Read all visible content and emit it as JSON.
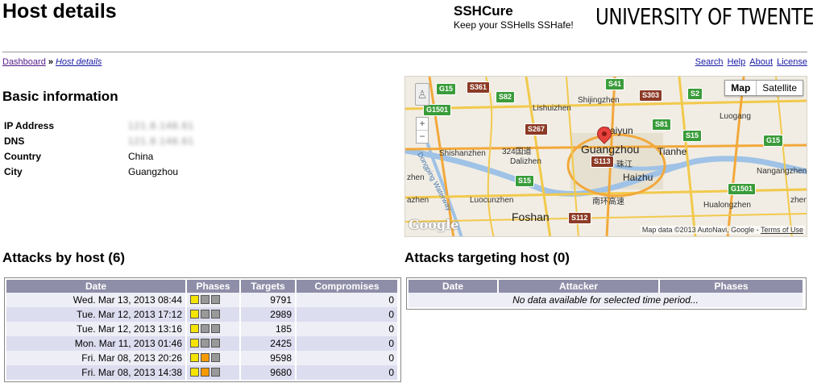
{
  "header": {
    "title": "Host details",
    "brand_name": "SSHCure",
    "brand_tagline": "Keep your SSHells SSHafe!",
    "university": "UNIVERSITY OF TWENTE."
  },
  "breadcrumb": {
    "home": "Dashboard",
    "separator": "»",
    "current": "Host details"
  },
  "toplinks": [
    "Search",
    "Help",
    "About",
    "License"
  ],
  "basic_info": {
    "heading": "Basic information",
    "rows": [
      {
        "label": "IP Address",
        "value": "121.8.148.61",
        "obscured": true
      },
      {
        "label": "DNS",
        "value": "121.8.148.61",
        "obscured": true
      },
      {
        "label": "Country",
        "value": "China",
        "obscured": false
      },
      {
        "label": "City",
        "value": "Guangzhou",
        "obscured": false
      }
    ]
  },
  "map": {
    "type_active": "Map",
    "type_other": "Satellite",
    "zoom_in": "+",
    "zoom_out": "−",
    "logo": "Google",
    "attribution": "Map data ©2013 AutoNavi, Google - ",
    "terms": "Terms of Use",
    "labels": {
      "shijingzhen": "Shijingzhen",
      "lishuizhen": "Lishuizhen",
      "baiyun": "Baiyun",
      "luogang": "Luogang",
      "shishanzhen": "Shishanzhen",
      "road324": "324国道",
      "guangzhou": "Guangzhou",
      "tianhe": "Tianhe",
      "dalizhen": "Dalizhen",
      "haizhu": "Haizhu",
      "zhujiang": "珠江",
      "nangangzhen": "Nangangzhen",
      "luocunzhen": "Luocunzhen",
      "ring": "南环高速",
      "foshan": "Foshan",
      "hualongzhen": "Hualongzhen",
      "waterway": "Dongping Waterway",
      "left_zhen": "zhen",
      "left_azhen": "azhen",
      "right_zhen": "zhen"
    },
    "shields": [
      "G15",
      "S361",
      "S82",
      "S41",
      "S303",
      "S2",
      "G1501",
      "S81",
      "S15",
      "G15",
      "S267",
      "S113",
      "S15",
      "S112",
      "G1501"
    ]
  },
  "attacks_by_host": {
    "heading": "Attacks by host (6)",
    "columns": [
      "Date",
      "Phases",
      "Targets",
      "Compromises"
    ],
    "rows": [
      {
        "date": "Wed. Mar 13, 2013 08:44",
        "phases": [
          "#f5e400",
          "#999999",
          "#999999"
        ],
        "targets": "9791",
        "compromises": "0"
      },
      {
        "date": "Tue. Mar 12, 2013 17:12",
        "phases": [
          "#f5e400",
          "#999999",
          "#999999"
        ],
        "targets": "2989",
        "compromises": "0"
      },
      {
        "date": "Tue. Mar 12, 2013 13:16",
        "phases": [
          "#f5e400",
          "#999999",
          "#999999"
        ],
        "targets": "185",
        "compromises": "0"
      },
      {
        "date": "Mon. Mar 11, 2013 01:46",
        "phases": [
          "#f5e400",
          "#999999",
          "#999999"
        ],
        "targets": "2425",
        "compromises": "0"
      },
      {
        "date": "Fri. Mar 08, 2013 20:26",
        "phases": [
          "#f5e400",
          "#f59a00",
          "#999999"
        ],
        "targets": "9598",
        "compromises": "0"
      },
      {
        "date": "Fri. Mar 08, 2013 14:38",
        "phases": [
          "#f5e400",
          "#f59a00",
          "#999999"
        ],
        "targets": "9680",
        "compromises": "0"
      }
    ]
  },
  "attacks_targeting_host": {
    "heading": "Attacks targeting host (0)",
    "columns": [
      "Date",
      "Attacker",
      "Phases"
    ],
    "empty_message": "No data available for selected time period..."
  }
}
